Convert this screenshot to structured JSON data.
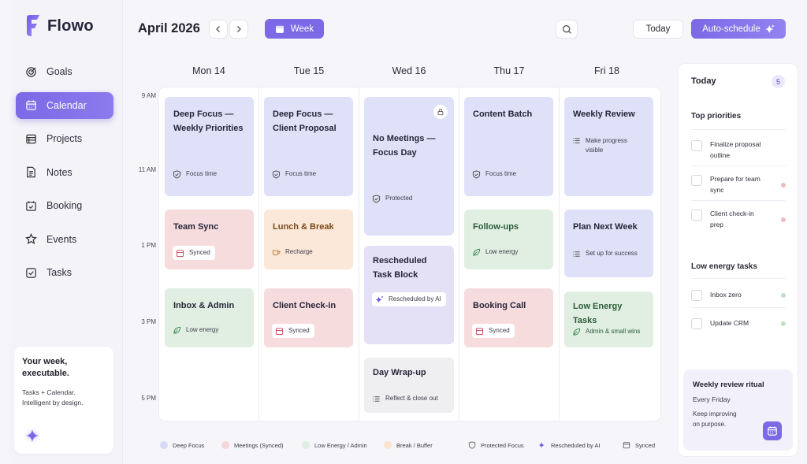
{
  "app": {
    "name": "Flowo",
    "accent": "#7b69e6"
  },
  "sidebar": {
    "items": [
      {
        "label": "Goals",
        "icon": "target-icon"
      },
      {
        "label": "Calendar",
        "icon": "calendar-icon",
        "active": true
      },
      {
        "label": "Projects",
        "icon": "folder-icon"
      },
      {
        "label": "Notes",
        "icon": "note-icon"
      },
      {
        "label": "Booking",
        "icon": "booking-icon"
      },
      {
        "label": "Events",
        "icon": "star-icon"
      },
      {
        "label": "Tasks",
        "icon": "checkbox-icon"
      }
    ],
    "promo": {
      "title_line1": "Your week,",
      "title_line2": "executable.",
      "sub_line1": "Tasks + Calendar.",
      "sub_line2": "Intelligent by design."
    }
  },
  "header": {
    "month": "April 2026",
    "view_label": "Week",
    "today_label": "Today",
    "auto_label": "Auto-schedule"
  },
  "days": [
    "Mon 14",
    "Tue 15",
    "Wed 16",
    "Thu 17",
    "Fri 18"
  ],
  "times": [
    "9 AM",
    "11 AM",
    "1 PM",
    "3 PM",
    "5 PM"
  ],
  "events": {
    "mon1": {
      "title1": "Deep Focus —",
      "title2": "Weekly Priorities",
      "tag": "Focus time"
    },
    "mon2": {
      "title": "Team Sync",
      "tag": "Synced"
    },
    "mon3": {
      "title": "Inbox & Admin",
      "tag": "Low energy"
    },
    "tue1": {
      "title1": "Deep Focus —",
      "title2": "Client Proposal",
      "tag": "Focus time"
    },
    "tue2": {
      "title": "Lunch & Break",
      "tag": "Recharge"
    },
    "tue3": {
      "title": "Client Check-in",
      "tag": "Synced"
    },
    "wed1": {
      "title1": "No Meetings —",
      "title2": "Focus Day",
      "tag": "Protected"
    },
    "wed2": {
      "title1": "Rescheduled",
      "title2": "Task Block",
      "tag": "Rescheduled by AI"
    },
    "wed3": {
      "title": "Day Wrap-up",
      "tag": "Reflect & close out"
    },
    "thu1": {
      "title": "Content Batch",
      "tag": "Focus time"
    },
    "thu2": {
      "title": "Follow-ups",
      "tag": "Low energy"
    },
    "thu3": {
      "title": "Booking Call",
      "tag": "Synced"
    },
    "fri1": {
      "title": "Weekly Review",
      "tag1": "Make progress",
      "tag2": "visible"
    },
    "fri2": {
      "title": "Plan Next Week",
      "tag": "Set up for success"
    },
    "fri3": {
      "title": "Low Energy Tasks",
      "tag": "Admin & small wins"
    }
  },
  "legend": {
    "deep_focus": "Deep Focus",
    "meetings": "Meetings (Synced)",
    "low_energy": "Low Energy / Admin",
    "break": "Break / Buffer",
    "protected": "Protected Focus",
    "rescheduled": "Rescheduled by AI",
    "synced": "Synced"
  },
  "today_panel": {
    "title": "Today",
    "count": "5",
    "top_priorities_label": "Top priorities",
    "priorities": [
      {
        "line1": "Finalize proposal",
        "line2": "outline",
        "dot": ""
      },
      {
        "line1": "Prepare for team",
        "line2": "sync",
        "dot": "#f2b8bf"
      },
      {
        "line1": "Client check-in",
        "line2": "prep",
        "dot": "#f2b8bf"
      }
    ],
    "low_energy_label": "Low energy tasks",
    "low_energy": [
      {
        "label": "Inbox zero",
        "dot": "#bfe0c5"
      },
      {
        "label": "Update CRM",
        "dot": "#bfe0c5"
      }
    ],
    "ritual": {
      "title": "Weekly review ritual",
      "sub": "Every Friday",
      "note1": "Keep improving",
      "note2": "on purpose."
    }
  }
}
